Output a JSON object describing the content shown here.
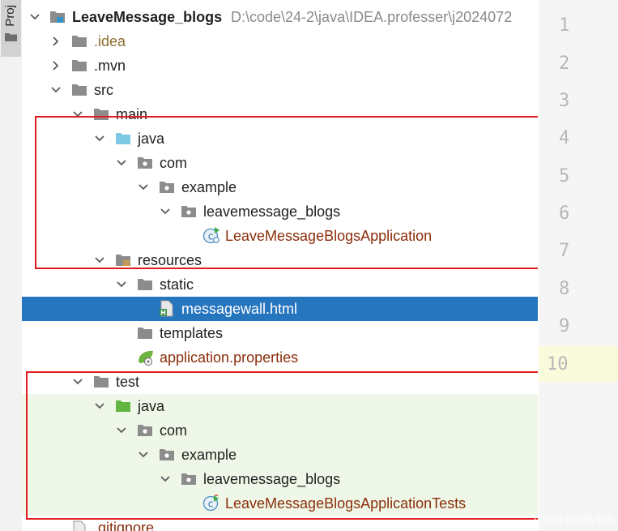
{
  "tool_window": {
    "tab_label": "Proj"
  },
  "project": {
    "name": "LeaveMessage_blogs",
    "path": "D:\\code\\24-2\\java\\IDEA.professer\\j2024072"
  },
  "tree": {
    "idea": ".idea",
    "mvn": ".mvn",
    "src": "src",
    "main": "main",
    "main_java": "java",
    "main_com": "com",
    "main_example": "example",
    "main_pkg": "leavemessage_blogs",
    "main_class": "LeaveMessageBlogsApplication",
    "resources": "resources",
    "static": "static",
    "messagewall": "messagewall.html",
    "templates": "templates",
    "app_props": "application.properties",
    "test": "test",
    "test_java": "java",
    "test_com": "com",
    "test_example": "example",
    "test_pkg": "leavemessage_blogs",
    "test_class": "LeaveMessageBlogsApplicationTests",
    "gitignore": ".gitignore"
  },
  "gutter": {
    "lines": [
      "1",
      "2",
      "3",
      "4",
      "5",
      "6",
      "7",
      "8",
      "9",
      "10"
    ]
  },
  "watermark": "CSDN @小高不明",
  "colors": {
    "selection": "#2675bf",
    "test_background": "#eff8e8",
    "annotation": "#e31a1c"
  }
}
